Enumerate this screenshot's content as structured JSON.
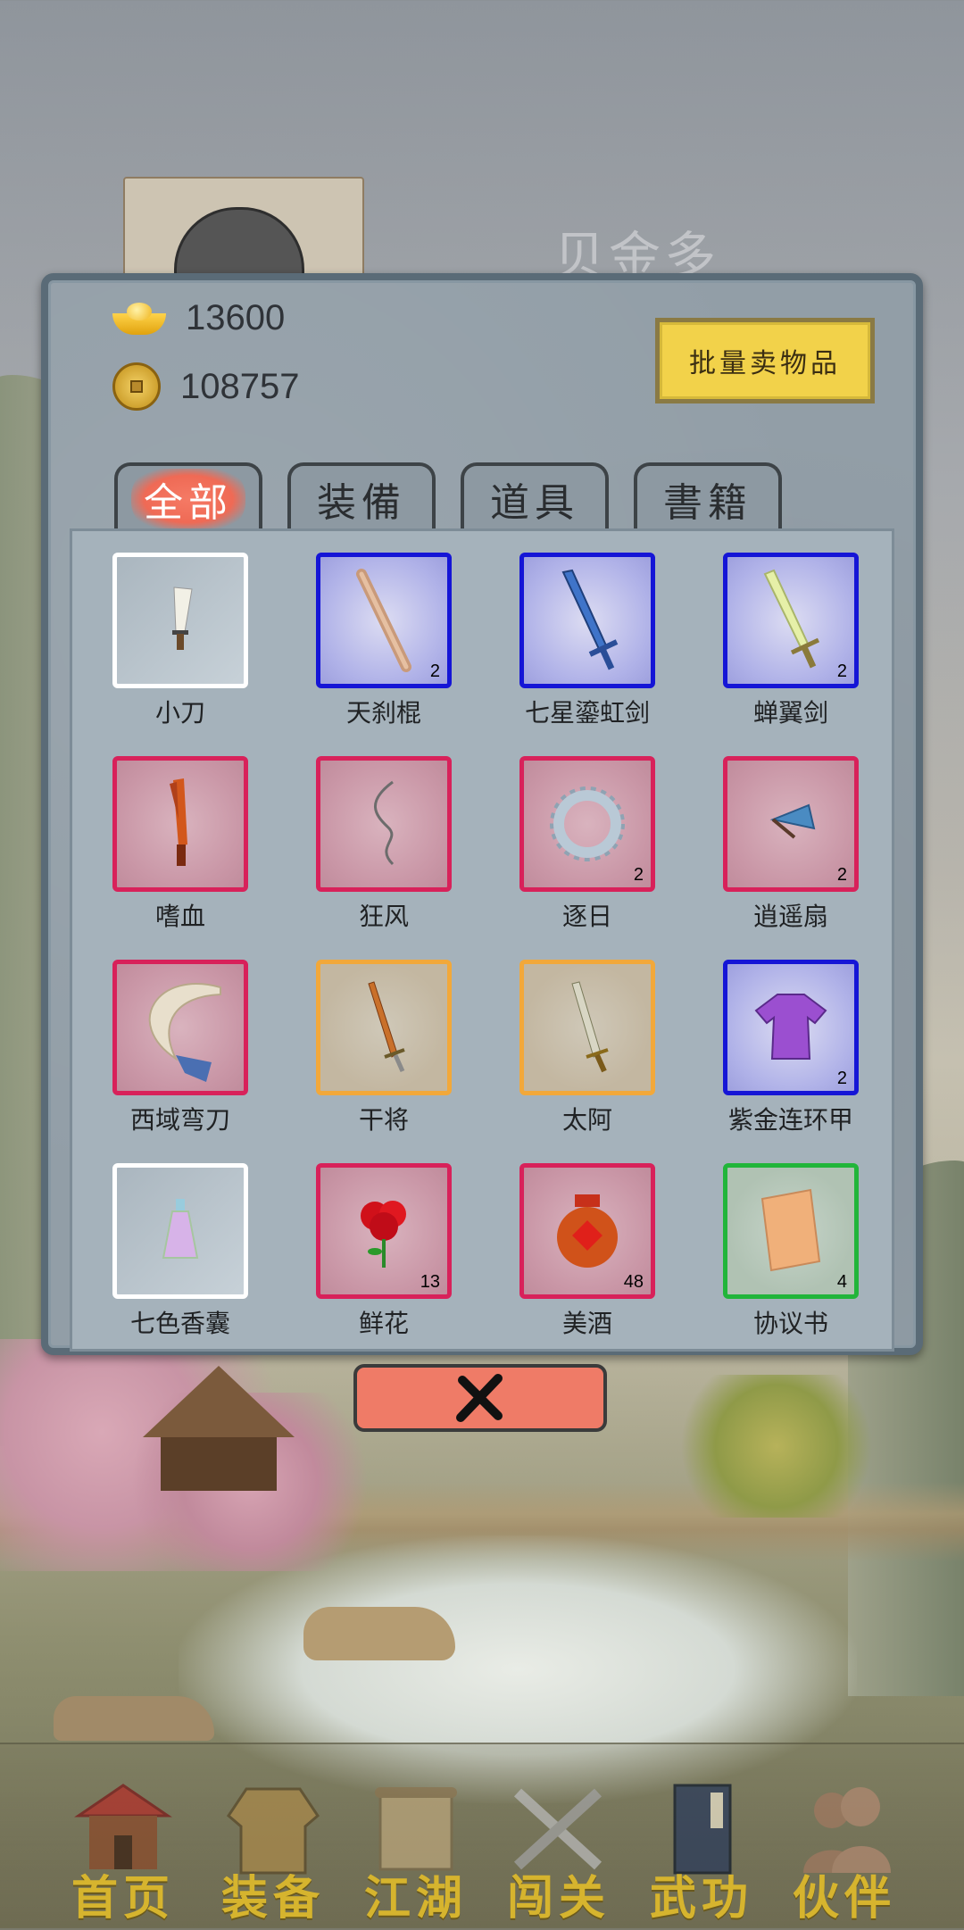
{
  "hero": {
    "name": "贝金多"
  },
  "currency": {
    "ingot": "13600",
    "coins": "108757"
  },
  "sell_button_label": "批量卖物品",
  "tabs": [
    {
      "label": "全部",
      "active": true
    },
    {
      "label": "装備",
      "active": false
    },
    {
      "label": "道具",
      "active": false
    },
    {
      "label": "書籍",
      "active": false
    }
  ],
  "items": [
    {
      "name": "小刀",
      "quality": "white",
      "count": "",
      "icon": "knife-icon"
    },
    {
      "name": "天刹棍",
      "quality": "blue",
      "count": "2",
      "icon": "staff-icon"
    },
    {
      "name": "七星鎏虹剑",
      "quality": "blue",
      "count": "",
      "icon": "blue-sword-icon"
    },
    {
      "name": "蝉翼剑",
      "quality": "blue",
      "count": "2",
      "icon": "pale-sword-icon"
    },
    {
      "name": "嗜血",
      "quality": "pink",
      "count": "",
      "icon": "blood-blade-icon"
    },
    {
      "name": "狂风",
      "quality": "pink",
      "count": "",
      "icon": "whip-icon"
    },
    {
      "name": "逐日",
      "quality": "pink",
      "count": "2",
      "icon": "sun-ring-icon"
    },
    {
      "name": "逍遥扇",
      "quality": "pink",
      "count": "2",
      "icon": "fan-icon"
    },
    {
      "name": "西域弯刀",
      "quality": "pink",
      "count": "",
      "icon": "scimitar-icon"
    },
    {
      "name": "干将",
      "quality": "orange",
      "count": "",
      "icon": "sword-icon"
    },
    {
      "name": "太阿",
      "quality": "orange",
      "count": "",
      "icon": "sword-icon"
    },
    {
      "name": "紫金连环甲",
      "quality": "blue",
      "count": "2",
      "icon": "armor-icon"
    },
    {
      "name": "七色香囊",
      "quality": "white",
      "count": "",
      "icon": "sachet-icon"
    },
    {
      "name": "鲜花",
      "quality": "pink",
      "count": "13",
      "icon": "rose-icon"
    },
    {
      "name": "美酒",
      "quality": "pink",
      "count": "48",
      "icon": "wine-jar-icon"
    },
    {
      "name": "协议书",
      "quality": "green",
      "count": "4",
      "icon": "contract-icon"
    }
  ],
  "nav": [
    {
      "label": "首页",
      "icon": "house-icon"
    },
    {
      "label": "装备",
      "icon": "armor-icon"
    },
    {
      "label": "江湖",
      "icon": "scroll-icon"
    },
    {
      "label": "闯关",
      "icon": "swords-icon"
    },
    {
      "label": "武功",
      "icon": "book-icon"
    },
    {
      "label": "伙伴",
      "icon": "partners-icon"
    }
  ]
}
